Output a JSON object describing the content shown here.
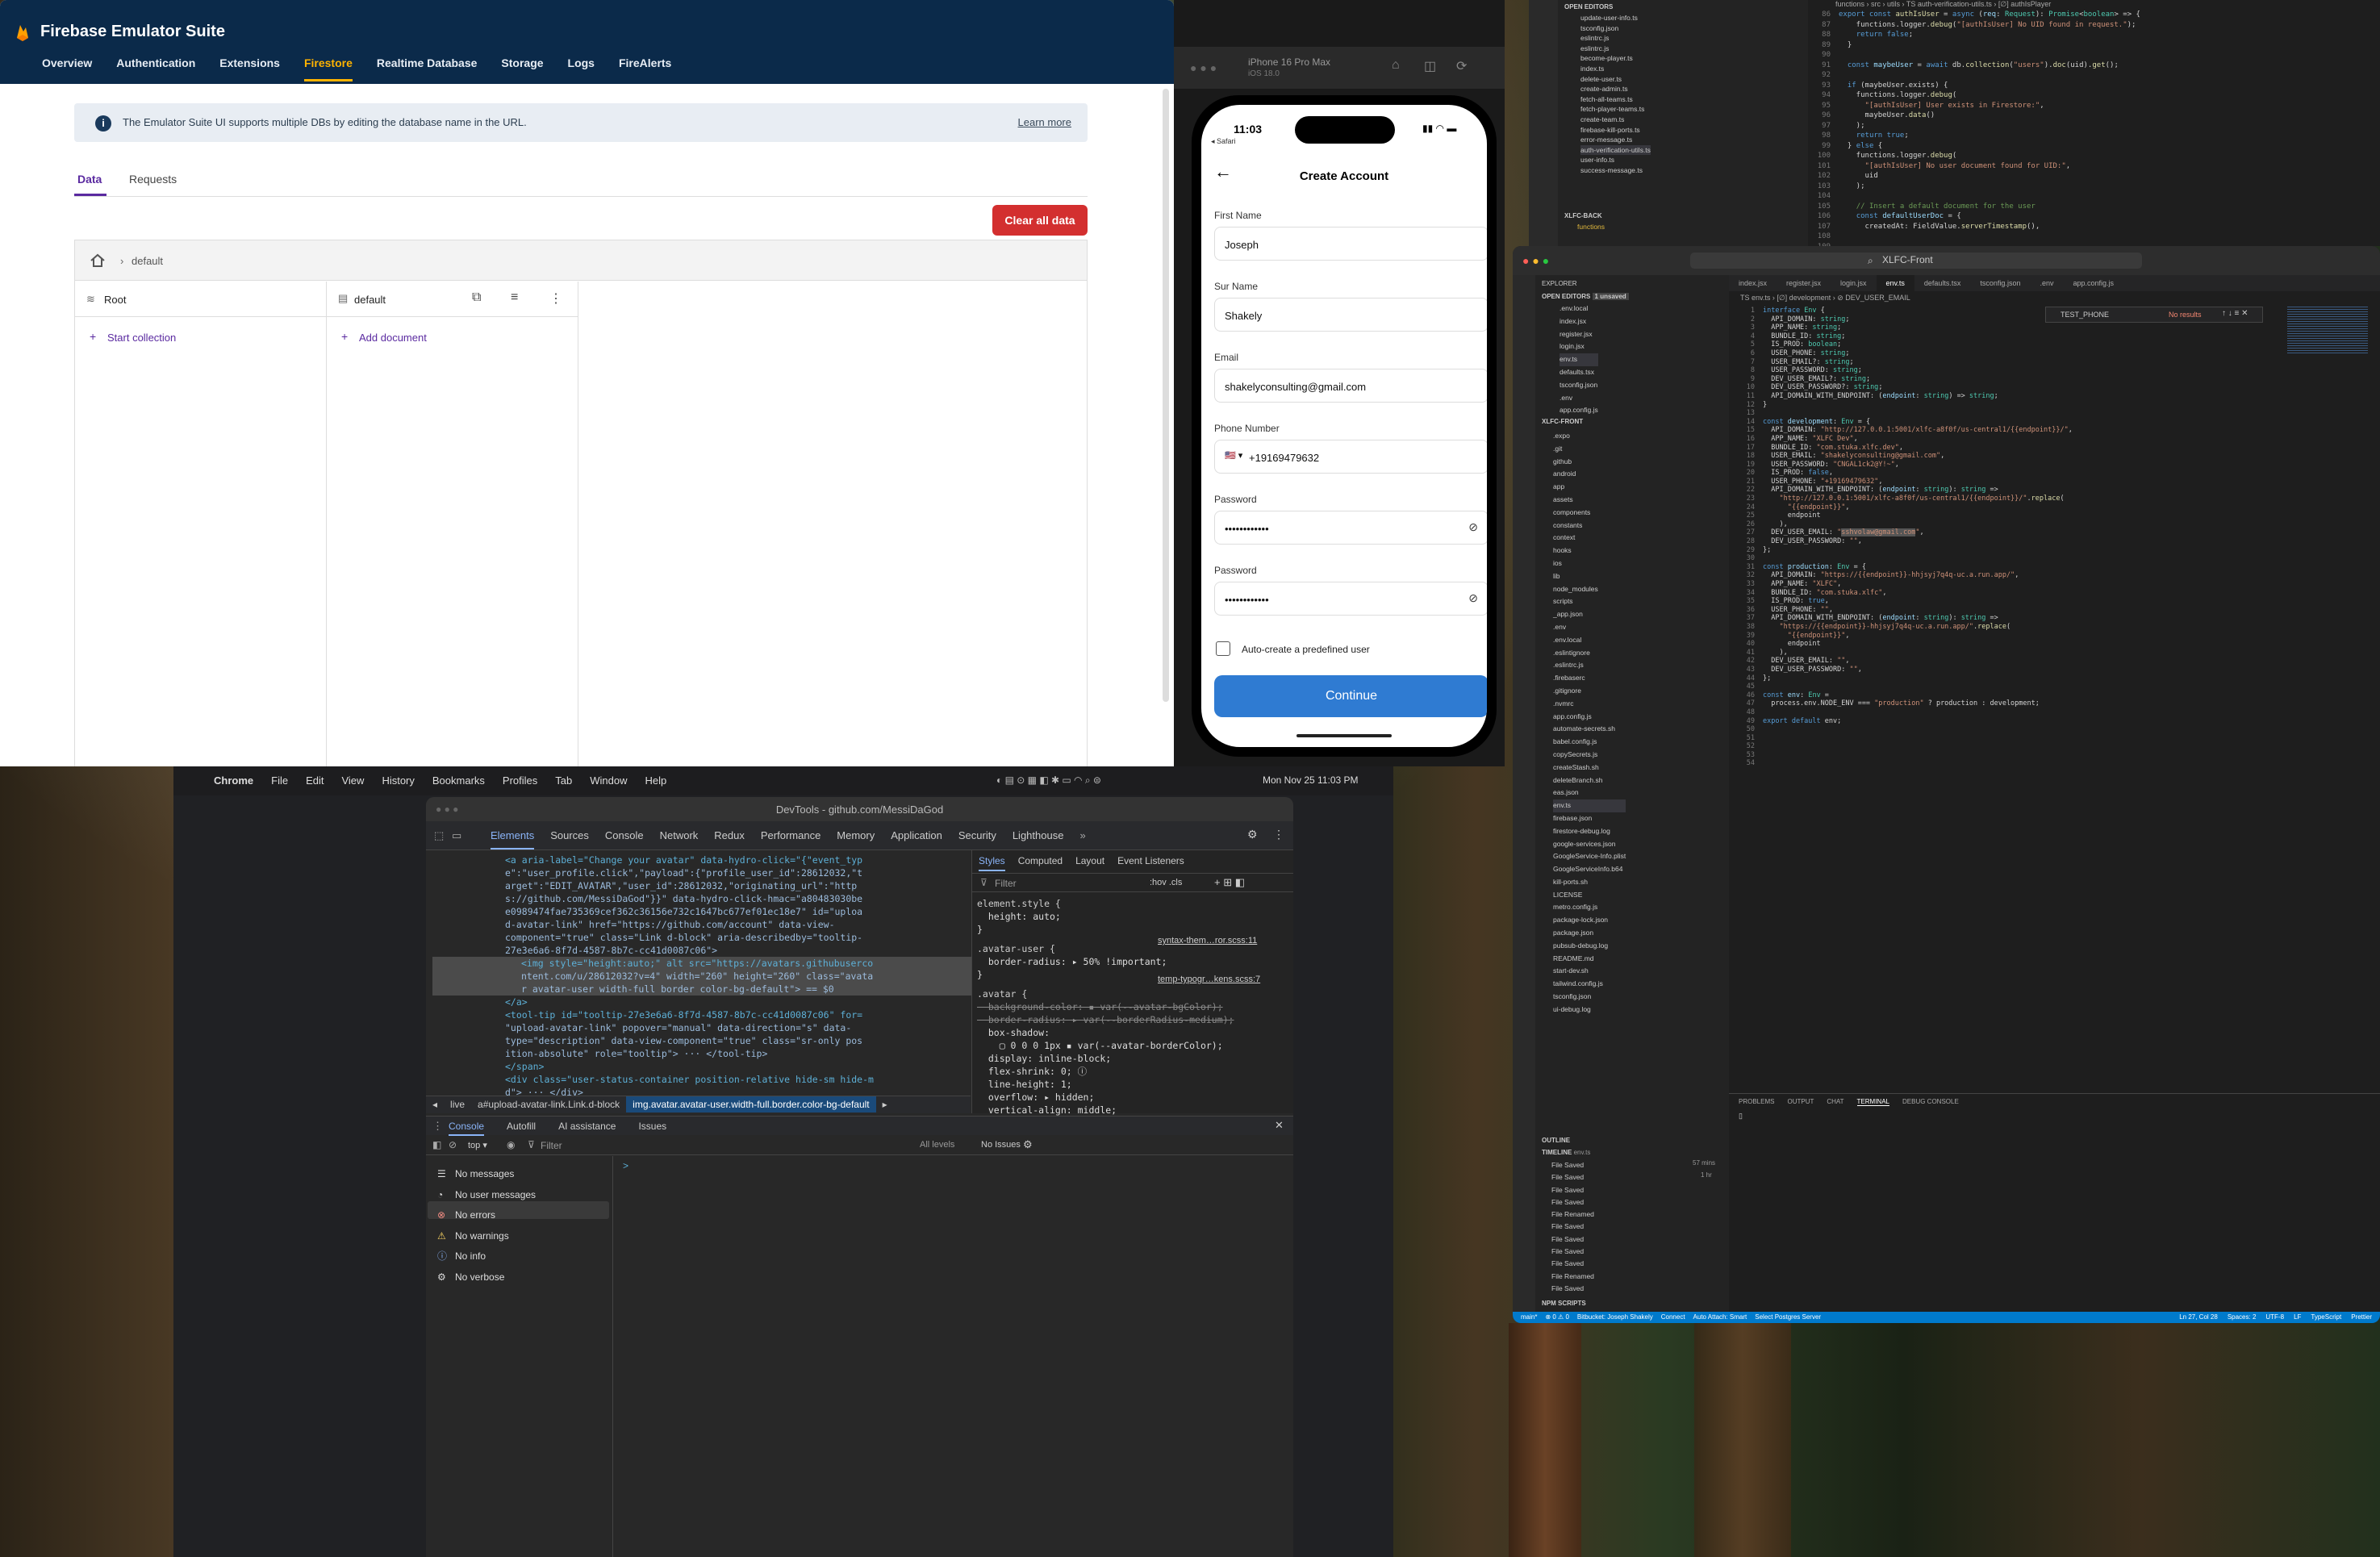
{
  "firebase": {
    "title": "Firebase Emulator Suite",
    "tabs": [
      "Overview",
      "Authentication",
      "Extensions",
      "Firestore",
      "Realtime Database",
      "Storage",
      "Logs",
      "FireAlerts"
    ],
    "active_tab": "Firestore",
    "info_message": "The Emulator Suite UI supports multiple DBs by editing the database name in the URL.",
    "learn_more": "Learn more",
    "subtabs": [
      "Data",
      "Requests"
    ],
    "clear_all": "Clear all data",
    "breadcrumb": "default",
    "root_label": "Root",
    "db_label": "default",
    "start_collection": "Start collection",
    "add_document": "Add document"
  },
  "simulator": {
    "device": "iPhone 16 Pro Max",
    "os": "iOS 18.0",
    "time": "11:03",
    "back_app": "Safari",
    "screen_title": "Create Account",
    "fields": [
      {
        "label": "First Name",
        "value": "Joseph"
      },
      {
        "label": "Sur Name",
        "value": "Shakely"
      },
      {
        "label": "Email",
        "value": "shakelyconsulting@gmail.com"
      },
      {
        "label": "Phone Number",
        "value": "+19169479632"
      },
      {
        "label": "Password",
        "value": "••••••••••••"
      },
      {
        "label": "Password",
        "value": "••••••••••••"
      }
    ],
    "checkbox_label": "Auto-create a predefined user",
    "continue": "Continue"
  },
  "vscode_top": {
    "breadcrumb": "functions › src › utils › TS auth-verification-utils.ts › [∅] authIsPlayer",
    "open_editors": "OPEN EDITORS",
    "files": [
      "update-user-info.ts",
      "tsconfig.json",
      "eslintrc.js",
      "eslintrc.js",
      "become-player.ts",
      "index.ts",
      "delete-user.ts",
      "create-admin.ts",
      "fetch-all-teams.ts",
      "fetch-player-teams.ts",
      "create-team.ts",
      "firebase-kill-ports.ts",
      "error-message.ts",
      "auth-verification-utils.ts",
      "user-info.ts",
      "success-message.ts"
    ],
    "section": "XLFC-BACK",
    "folder": "functions",
    "gutter_start": 86
  },
  "vscode": {
    "window_title": "XLFC-Front",
    "tabs": [
      "index.jsx",
      "register.jsx",
      "login.jsx",
      "env.ts",
      "defaults.tsx",
      "tsconfig.json",
      ".env",
      "app.config.js"
    ],
    "breadcrumb": "TS env.ts › [∅] development › ⊘ DEV_USER_EMAIL",
    "explorer": "EXPLORER",
    "open_editors": "OPEN EDITORS",
    "unsaved": "1 unsaved",
    "open_files": [
      ".env.local",
      "index.jsx",
      "register.jsx",
      "login.jsx",
      "env.ts",
      "defaults.tsx",
      "tsconfig.json",
      ".env",
      "app.config.js"
    ],
    "project": "XLFC-FRONT",
    "project_files": [
      ".expo",
      ".git",
      "github",
      "android",
      "app",
      "assets",
      "components",
      "constants",
      "context",
      "hooks",
      "ios",
      "lib",
      "node_modules",
      "scripts",
      "_app.json",
      ".env",
      ".env.local",
      ".eslintignore",
      ".eslintrc.js",
      ".firebaserc",
      ".gitignore",
      ".nvmrc",
      "app.config.js",
      "automate-secrets.sh",
      "babel.config.js",
      "copySecrets.js",
      "createStash.sh",
      "deleteBranch.sh",
      "eas.json",
      "env.ts",
      "firebase.json",
      "firestore-debug.log",
      "google-services.json",
      "GoogleService-Info.plist",
      "GoogleServiceInfo.b64",
      "kill-ports.sh",
      "LICENSE",
      "metro.config.js",
      "package-lock.json",
      "package.json",
      "pubsub-debug.log",
      "README.md",
      "start-dev.sh",
      "tailwind.config.js",
      "tsconfig.json",
      "ui-debug.log"
    ],
    "find_text": "TEST_PHONE",
    "find_result": "No results",
    "panel_tabs": [
      "PROBLEMS",
      "OUTPUT",
      "CHAT",
      "TERMINAL",
      "DEBUG CONSOLE"
    ],
    "outline": "OUTLINE",
    "timeline": "TIMELINE",
    "timeline_file": "env.ts",
    "timeline_items": [
      "File Saved",
      "File Saved",
      "File Saved",
      "File Saved",
      "File Renamed",
      "File Saved",
      "File Saved",
      "File Saved",
      "File Saved",
      "File Renamed",
      "File Saved"
    ],
    "timeline_times": [
      "57 mins",
      "1 hr"
    ],
    "npm_scripts": "NPM SCRIPTS",
    "status_left": [
      "main*",
      "⊗ 0 ⚠ 0",
      "Bitbucket: Joseph Shakely",
      "Connect",
      "Auto Attach: Smart",
      "Select Postgres Server"
    ],
    "status_right": [
      "Ln 27, Col 28",
      "Spaces: 2",
      "UTF-8",
      "LF",
      "TypeScript",
      "Prettier"
    ]
  },
  "chrome": {
    "menu": [
      "Chrome",
      "File",
      "Edit",
      "View",
      "History",
      "Bookmarks",
      "Profiles",
      "Tab",
      "Window",
      "Help"
    ],
    "clock": "Mon Nov 25  11:03 PM",
    "window_title": "DevTools - github.com/MessiDaGod",
    "panel_tabs": [
      "Elements",
      "Sources",
      "Console",
      "Network",
      "Redux",
      "Performance",
      "Memory",
      "Application",
      "Security",
      "Lighthouse"
    ],
    "style_tabs": [
      "Styles",
      "Computed",
      "Layout",
      "Event Listeners"
    ],
    "filter": "Filter",
    "filter_flags": ":hov  .cls",
    "dom_lines": [
      "<a aria-label=\"Change your avatar\" data-hydro-click=\"{\"event_typ",
      "e\":\"user_profile.click\",\"payload\":{\"profile_user_id\":28612032,\"t",
      "arget\":\"EDIT_AVATAR\",\"user_id\":28612032,\"originating_url\":\"http",
      "s://github.com/MessiDaGod\"}}\" data-hydro-click-hmac=\"a80483030be",
      "e0989474fae735369cef362c36156e732c1647bc677ef01ec18e7\" id=\"uploa",
      "d-avatar-link\" href=\"https://github.com/account\" data-view-",
      "component=\"true\" class=\"Link d-block\" aria-describedby=\"tooltip-",
      "27e3e6a6-8f7d-4587-8b7c-cc41d0087c06\">",
      "<img style=\"height:auto;\" alt src=\"https://avatars.githubuserco",
      "ntent.com/u/28612032?v=4\" width=\"260\" height=\"260\" class=\"avata",
      "r avatar-user width-full border color-bg-default\"> == $0",
      "</a>",
      "<tool-tip id=\"tooltip-27e3e6a6-8f7d-4587-8b7c-cc41d0087c06\" for=",
      "\"upload-avatar-link\" popover=\"manual\" data-direction=\"s\" data-",
      "type=\"description\" data-view-component=\"true\" class=\"sr-only pos",
      "ition-absolute\" role=\"tooltip\"> ··· </tool-tip>",
      "</span>",
      "<div class=\"user-status-container position-relative hide-sm hide-m",
      "d\"> ··· </div>"
    ],
    "css_lines": [
      "element.style {",
      "  height: auto;",
      "}",
      ".avatar-user {",
      "  border-radius: ▸ 50% !important;",
      "}",
      ".avatar {",
      "  background-color: ▪ var(--avatar-bgColor);",
      "  border-radius: ▸ var(--borderRadius-medium);",
      "  box-shadow:",
      "    ▢ 0 0 0 1px ▪ var(--avatar-borderColor);",
      "  display: inline-block;",
      "  flex-shrink: 0; ⓘ",
      "  line-height: 1;",
      "  overflow: ▸ hidden;",
      "  vertical-align: middle;"
    ],
    "css_sources": [
      "syntax-them…ror.scss:11",
      "temp-typogr…kens.scss:7"
    ],
    "crumbs": [
      "◂",
      "live",
      "a#upload-avatar-link.Link.d-block",
      "img.avatar.avatar-user.width-full.border.color-bg-default",
      "▸"
    ],
    "drawer_tabs": [
      "Console",
      "Autofill",
      "AI assistance",
      "Issues"
    ],
    "context": "top",
    "console_filter": "Filter",
    "levels": "All levels",
    "issues": "No Issues",
    "sidebar": [
      "No messages",
      "No user messages",
      "No errors",
      "No warnings",
      "No info",
      "No verbose"
    ],
    "prompt": ">"
  }
}
